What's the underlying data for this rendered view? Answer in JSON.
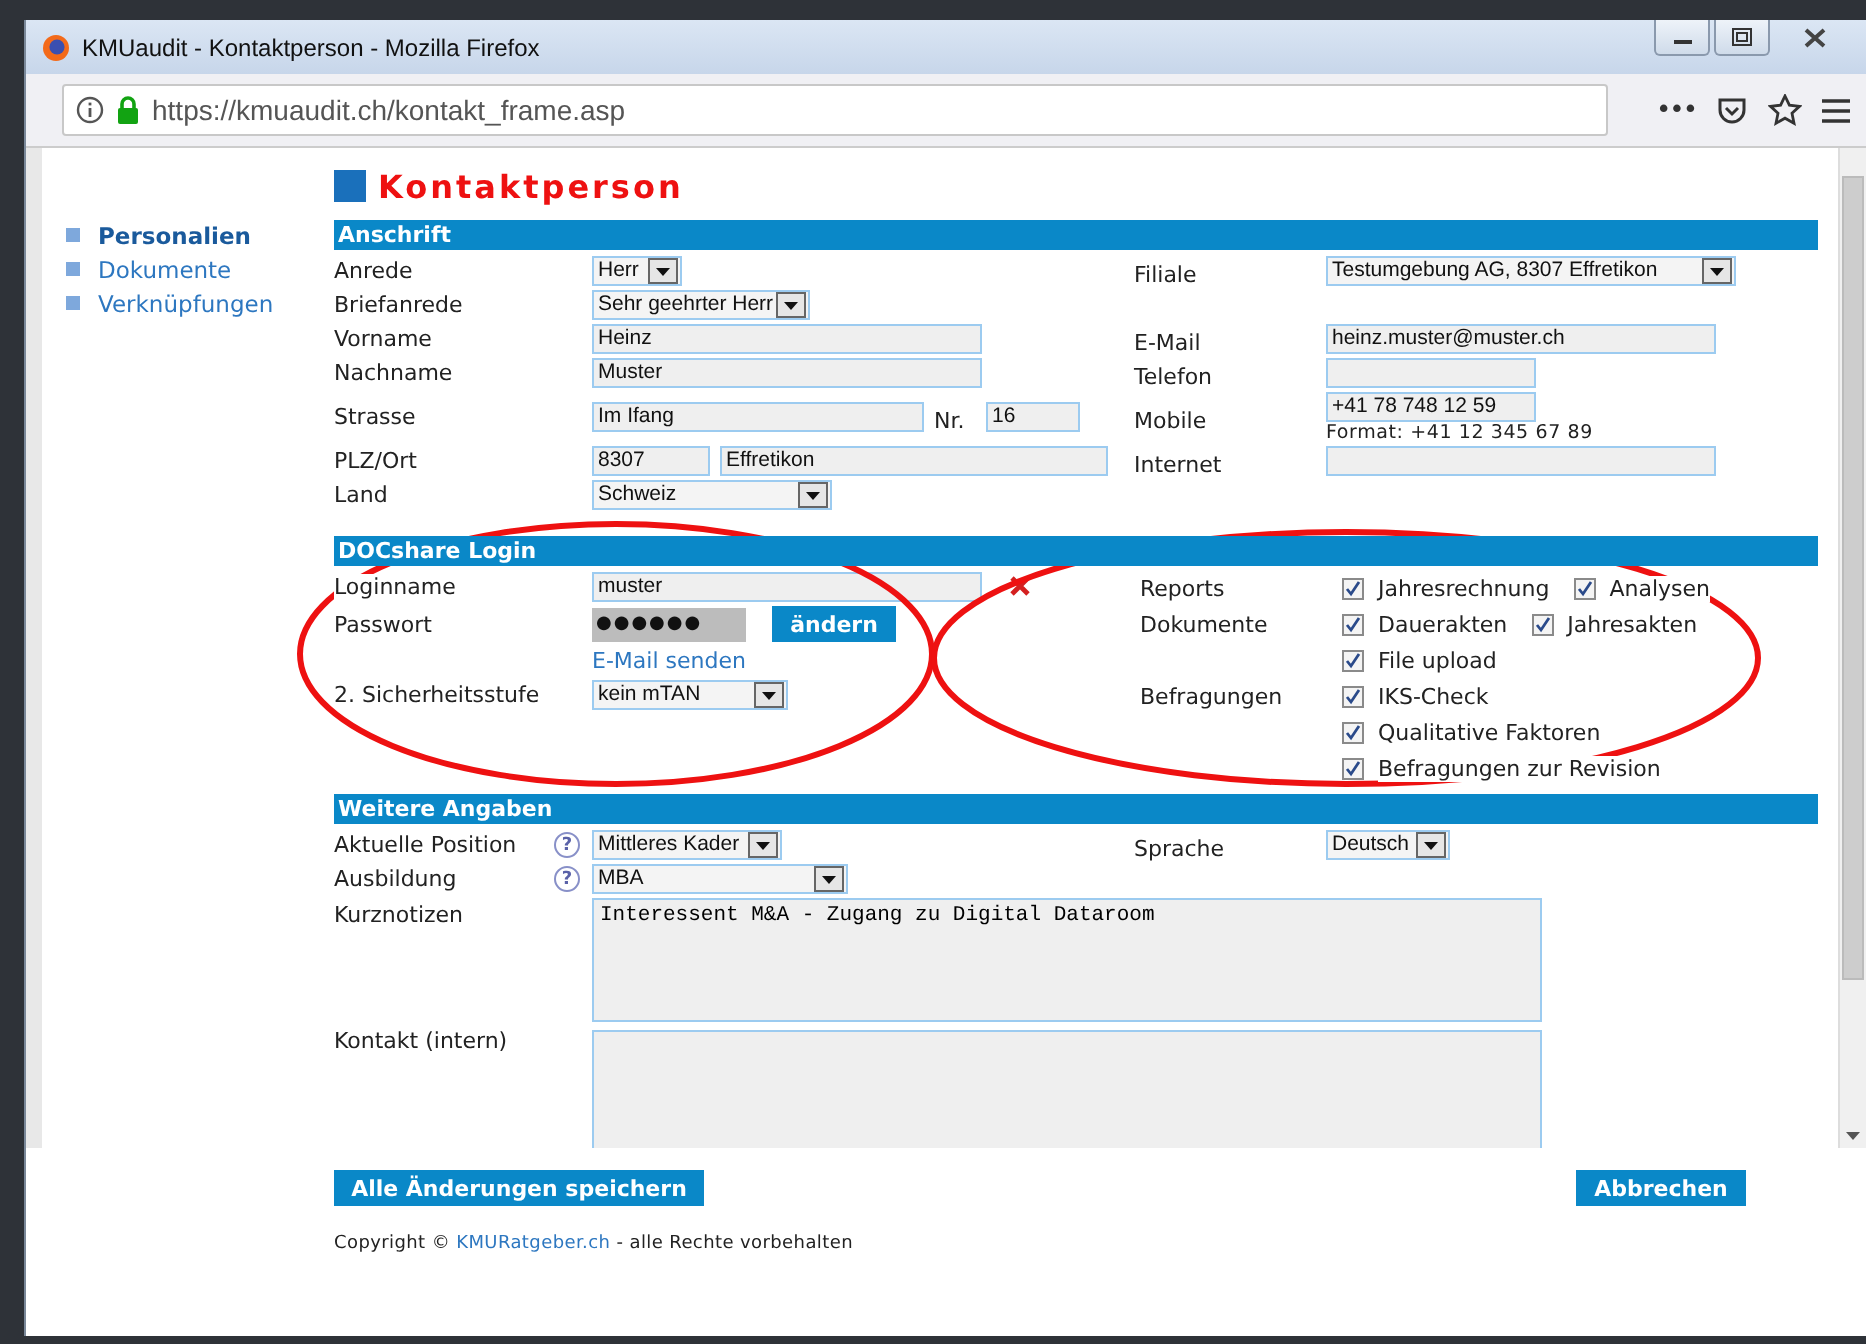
{
  "window": {
    "title": "KMUaudit - Kontaktperson - Mozilla Firefox",
    "url": "https://kmuaudit.ch/kontakt_frame.asp",
    "more": "•••"
  },
  "nav": [
    {
      "label": "Personalien",
      "selected": true
    },
    {
      "label": "Dokumente",
      "selected": false
    },
    {
      "label": "Verknüpfungen",
      "selected": false
    }
  ],
  "page_title": "Kontaktperson",
  "anschrift": {
    "title": "Anschrift",
    "anrede": {
      "label": "Anrede",
      "value": "Herr"
    },
    "briefanrede": {
      "label": "Briefanrede",
      "value": "Sehr geehrter Herr"
    },
    "vorname": {
      "label": "Vorname",
      "value": "Heinz"
    },
    "nachname": {
      "label": "Nachname",
      "value": "Muster"
    },
    "strasse": {
      "label": "Strasse",
      "value": "Im Ifang"
    },
    "nr": {
      "label": "Nr.",
      "value": "16"
    },
    "plz": {
      "label": "PLZ/Ort",
      "value": "8307"
    },
    "ort": {
      "value": "Effretikon"
    },
    "land": {
      "label": "Land",
      "value": "Schweiz"
    },
    "filiale": {
      "label": "Filiale",
      "value": "Testumgebung AG, 8307 Effretikon"
    },
    "email": {
      "label": "E-Mail",
      "value": "heinz.muster@muster.ch"
    },
    "telefon": {
      "label": "Telefon"
    },
    "mobile": {
      "label": "Mobile",
      "value": "+41 78 748 12 59",
      "hint": "Format: +41 12 345 67 89"
    },
    "internet": {
      "label": "Internet"
    }
  },
  "login": {
    "title": "DOCshare Login",
    "loginname": {
      "label": "Loginname",
      "value": "muster"
    },
    "passwort": {
      "label": "Passwort",
      "value": "●●●●●●",
      "button": "ändern"
    },
    "email_link": "E-Mail senden",
    "sicherheitsstufe": {
      "label": "2. Sicherheitsstufe",
      "value": "kein mTAN"
    },
    "groups": [
      {
        "label": "Reports",
        "lines": [
          [
            {
              "label": "Jahresrechnung",
              "checked": true
            },
            {
              "label": "Analysen",
              "checked": true
            }
          ]
        ]
      },
      {
        "label": "Dokumente",
        "lines": [
          [
            {
              "label": "Dauerakten",
              "checked": true
            },
            {
              "label": "Jahresakten",
              "checked": true
            }
          ],
          [
            {
              "label": "File upload",
              "checked": true
            }
          ]
        ]
      },
      {
        "label": "Befragungen",
        "lines": [
          [
            {
              "label": "IKS-Check",
              "checked": true
            }
          ],
          [
            {
              "label": "Qualitative Faktoren",
              "checked": true
            }
          ],
          [
            {
              "label": "Befragungen zur Revision",
              "checked": true
            }
          ]
        ]
      }
    ]
  },
  "weitere": {
    "title": "Weitere Angaben",
    "position": {
      "label": "Aktuelle Position",
      "help": "?",
      "value": "Mittleres Kader"
    },
    "ausbildung": {
      "label": "Ausbildung",
      "help": "?",
      "value": "MBA"
    },
    "sprache": {
      "label": "Sprache",
      "value": "Deutsch"
    },
    "kurznotizen": {
      "label": "Kurznotizen",
      "value": "Interessent M&A - Zugang zu Digital Dataroom"
    },
    "kontakt": {
      "label": "Kontakt (intern)"
    }
  },
  "buttons": {
    "save": "Alle Änderungen speichern",
    "cancel": "Abbrechen"
  },
  "footer": {
    "prefix": "Copyright © ",
    "link": "KMURatgeber.ch",
    "suffix": " - alle Rechte vorbehalten"
  }
}
